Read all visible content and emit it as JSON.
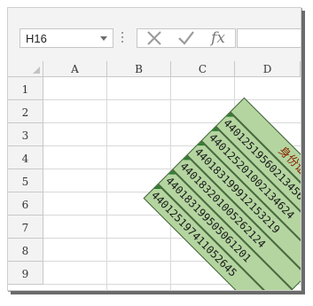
{
  "name_box": {
    "value": "H16"
  },
  "formula_bar": {
    "fx_label": "fx",
    "cancel_icon": "close-icon",
    "enter_icon": "checkmark-icon"
  },
  "columns": [
    "A",
    "B",
    "C",
    "D"
  ],
  "rows": [
    "1",
    "2",
    "3",
    "4",
    "5",
    "6",
    "7",
    "8",
    "9"
  ],
  "table": {
    "header": "身份证号",
    "ids": [
      "440125195602134562",
      "440125201002134624",
      "440183199912153219",
      "440183201005262124",
      "440183199505061201",
      "440125197411052645"
    ]
  }
}
